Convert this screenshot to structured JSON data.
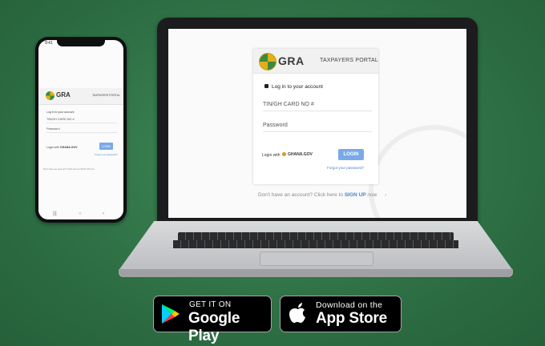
{
  "laptop_portal": {
    "logo_text": "GRA",
    "portal_title": "TAXPAYERS PORTAL",
    "login_heading": "Log in to your account",
    "tin_placeholder": "TIN/GH CARD NO #",
    "password_placeholder": "Password",
    "login_with": "Login with",
    "ghana_gov": "GHANA.GOV",
    "login_button": "LOGIN",
    "forgot_password": "Forgot your password?",
    "signup_prefix": "Don't have an account? Click here to",
    "signup_link": "SIGN UP",
    "signup_suffix": "now"
  },
  "phone_portal": {
    "time": "9:41",
    "logo_text": "GRA",
    "portal_title": "TAXPAYERS PORTAL",
    "login_heading": "Log in to your account",
    "tin_placeholder": "TIN/GH CARD NO #",
    "password_placeholder": "Password",
    "login_with": "Login with",
    "ghana_gov": "GHANA.GOV",
    "login_button": "LOGIN",
    "forgot_password": "Forgot your password?",
    "signup_text": "Don't have an account? Click here to SIGN UP now"
  },
  "stores": {
    "google_small": "GET IT ON",
    "google_big": "Google Play",
    "apple_small": "Download on the",
    "apple_big": "App Store"
  },
  "icons": [
    "lock-icon",
    "gra-logo-icon",
    "ghana-gov-icon",
    "chevron-right-icon",
    "google-play-icon",
    "apple-icon"
  ],
  "colors": {
    "background": "#2e6f44",
    "accent_blue": "#7aa9e8",
    "link_blue": "#4a7fd0"
  }
}
